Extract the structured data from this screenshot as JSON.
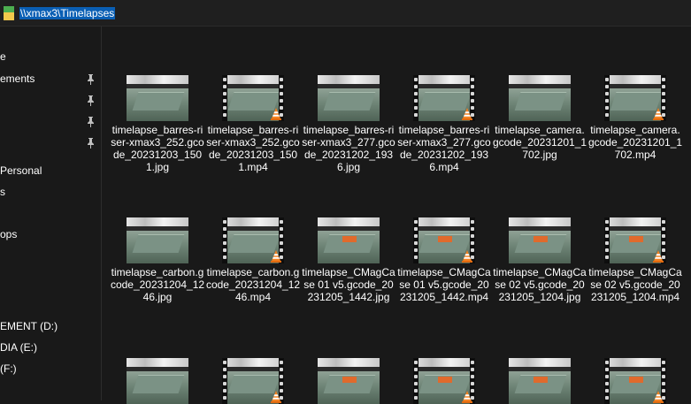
{
  "address_bar": {
    "path": "\\\\xmax3\\Timelapses"
  },
  "sidebar": {
    "items": [
      {
        "label": "e",
        "pinned": false
      },
      {
        "label": "ements",
        "pinned": true
      },
      {
        "label": "",
        "pinned": true
      },
      {
        "label": "",
        "pinned": true
      },
      {
        "label": "",
        "pinned": true
      },
      {
        "label": "Personal",
        "pinned": false
      },
      {
        "label": "s",
        "pinned": false
      },
      {
        "label": "ops",
        "pinned": false
      },
      {
        "label": "EMENT (D:)",
        "pinned": false
      },
      {
        "label": "DIA (E:)",
        "pinned": false
      },
      {
        "label": "(F:)",
        "pinned": false
      }
    ]
  },
  "files": [
    {
      "name": "timelapse_barres-riser-xmax3_252.gcode_20231203_1501.jpg",
      "type": "jpg"
    },
    {
      "name": "timelapse_barres-riser-xmax3_252.gcode_20231203_1501.mp4",
      "type": "mp4"
    },
    {
      "name": "timelapse_barres-riser-xmax3_277.gcode_20231202_1936.jpg",
      "type": "jpg"
    },
    {
      "name": "timelapse_barres-riser-xmax3_277.gcode_20231202_1936.mp4",
      "type": "mp4"
    },
    {
      "name": "timelapse_camera.gcode_20231201_1702.jpg",
      "type": "jpg"
    },
    {
      "name": "timelapse_camera.gcode_20231201_1702.mp4",
      "type": "mp4"
    },
    {
      "name": "timelapse_carbon.gcode_20231204_1246.jpg",
      "type": "jpg"
    },
    {
      "name": "timelapse_carbon.gcode_20231204_1246.mp4",
      "type": "mp4"
    },
    {
      "name": "timelapse_CMagCase 01 v5.gcode_20231205_1442.jpg",
      "type": "jpg"
    },
    {
      "name": "timelapse_CMagCase 01 v5.gcode_20231205_1442.mp4",
      "type": "mp4"
    },
    {
      "name": "timelapse_CMagCase 02 v5.gcode_20231205_1204.jpg",
      "type": "jpg"
    },
    {
      "name": "timelapse_CMagCase 02 v5.gcode_20231205_1204.mp4",
      "type": "mp4"
    },
    {
      "name": "",
      "type": "jpg"
    },
    {
      "name": "",
      "type": "mp4"
    },
    {
      "name": "",
      "type": "jpg"
    },
    {
      "name": "",
      "type": "mp4"
    },
    {
      "name": "",
      "type": "jpg"
    },
    {
      "name": "",
      "type": "mp4"
    }
  ],
  "icons": {
    "video_overlay": "vlc-cone-icon",
    "pin": "pin-icon",
    "folder": "network-folder-icon"
  },
  "colors": {
    "selection": "#0a5fb4",
    "background": "#191919",
    "vlc_orange": "#f58220"
  }
}
